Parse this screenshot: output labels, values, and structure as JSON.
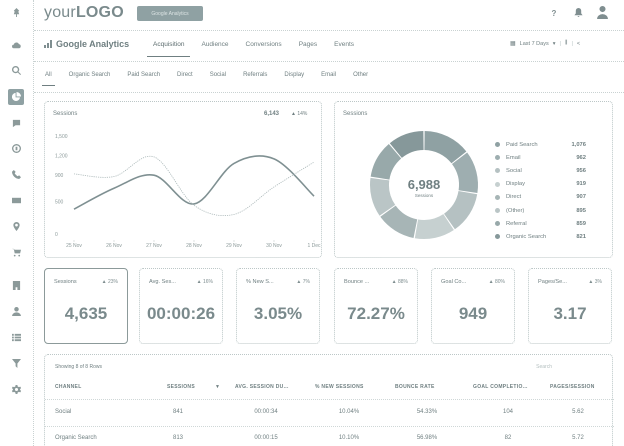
{
  "header": {
    "logo_text_light": "your",
    "logo_text_bold": "LOGO",
    "button_label": "Google Analytics",
    "help_icon": "help-icon",
    "notifications_icon": "bell-icon",
    "avatar_icon": "user-icon"
  },
  "sidebar": {
    "items": [
      {
        "icon": "pin-icon"
      },
      {
        "icon": "cloud-icon"
      },
      {
        "icon": "search-icon"
      },
      {
        "icon": "analytics-icon",
        "active": true
      },
      {
        "icon": "chat-icon"
      },
      {
        "icon": "globe-icon"
      },
      {
        "icon": "phone-icon"
      },
      {
        "icon": "mail-icon"
      },
      {
        "icon": "location-icon"
      },
      {
        "icon": "cart-icon"
      },
      {
        "icon": "building-icon"
      },
      {
        "icon": "person-icon"
      },
      {
        "icon": "list-icon"
      },
      {
        "icon": "filter-icon"
      },
      {
        "icon": "gear-icon"
      }
    ]
  },
  "analytics": {
    "title": "Google Analytics",
    "tabs": [
      "Acquisition",
      "Audience",
      "Conversions",
      "Pages",
      "Events"
    ],
    "active_tab": "Acquisition",
    "date_range": "Last 7 Days"
  },
  "channel_tabs": [
    "All",
    "Organic Search",
    "Paid Search",
    "Direct",
    "Social",
    "Referrals",
    "Display",
    "Email",
    "Other"
  ],
  "line_card": {
    "title": "Sessions",
    "total": "6,143",
    "delta": "▲ 14%"
  },
  "donut_card": {
    "title": "Sessions",
    "center_value": "6,988",
    "center_label": "Sessions",
    "legend": [
      {
        "name": "Paid Search",
        "value": "1,076"
      },
      {
        "name": "Email",
        "value": "962"
      },
      {
        "name": "Social",
        "value": "956"
      },
      {
        "name": "Display",
        "value": "919"
      },
      {
        "name": "Direct",
        "value": "907"
      },
      {
        "name": "(Other)",
        "value": "895"
      },
      {
        "name": "Referral",
        "value": "859"
      },
      {
        "name": "Organic Search",
        "value": "821"
      }
    ]
  },
  "kpis": [
    {
      "label": "Sessions",
      "delta": "▲ 23%",
      "value": "4,635"
    },
    {
      "label": "Avg. Ses...",
      "delta": "▲ 16%",
      "value": "00:00:26"
    },
    {
      "label": "% New S...",
      "delta": "▲ 7%",
      "value": "3.05%"
    },
    {
      "label": "Bounce ...",
      "delta": "▲ 88%",
      "value": "72.27%"
    },
    {
      "label": "Goal Co...",
      "delta": "▲ 80%",
      "value": "949"
    },
    {
      "label": "Pages/Se...",
      "delta": "▲ 3%",
      "value": "3.17"
    }
  ],
  "table": {
    "note": "Showing 8 of 8 Rows",
    "search_placeholder": "Search",
    "columns": [
      "CHANNEL",
      "SESSIONS",
      "AVG. SESSION DU...",
      "% NEW SESSIONS",
      "BOUNCE RATE",
      "GOAL COMPLETIO...",
      "PAGES/SESSION"
    ],
    "rows": [
      [
        "Social",
        "841",
        "00:00:34",
        "10.04%",
        "54.33%",
        "104",
        "5.62"
      ],
      [
        "Organic Search",
        "813",
        "00:00:15",
        "10.10%",
        "56.98%",
        "82",
        "5.72"
      ]
    ]
  },
  "chart_data": [
    {
      "type": "line",
      "title": "Sessions",
      "x": [
        "25 Nov",
        "26 Nov",
        "27 Nov",
        "28 Nov",
        "29 Nov",
        "30 Nov",
        "1 Dec"
      ],
      "ylim": [
        0,
        1500
      ],
      "yticks": [
        "0",
        "500",
        "900",
        "1,200",
        "1,500"
      ],
      "grid": false,
      "series": [
        {
          "values": [
            380,
            700,
            900,
            460,
            1080,
            1150,
            580
          ]
        },
        {
          "values": [
            920,
            880,
            1180,
            440,
            300,
            720,
            1100
          ]
        }
      ]
    },
    {
      "type": "pie",
      "title": "Sessions",
      "labels": [
        "Paid Search",
        "Email",
        "Social",
        "Display",
        "Direct",
        "(Other)",
        "Referral",
        "Organic Search"
      ],
      "values": [
        1076,
        962,
        956,
        919,
        907,
        895,
        859,
        821
      ],
      "colors": [
        "#8fa1a3",
        "#9eaeb0",
        "#b5c1c2",
        "#c6d0d0",
        "#a7b5b6",
        "#bac5c6",
        "#98a9aa",
        "#86989a"
      ],
      "legend": "right"
    }
  ]
}
